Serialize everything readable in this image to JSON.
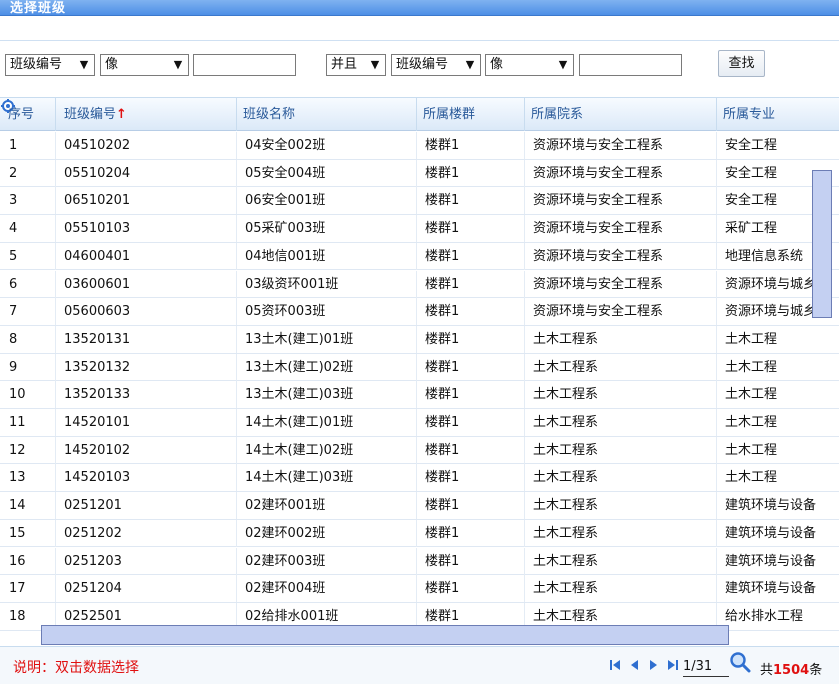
{
  "window": {
    "title": "选择班级"
  },
  "filter": {
    "field1": "班级编号",
    "op1": "像",
    "value1": "",
    "logic": "并且",
    "field2": "班级编号",
    "op2": "像",
    "value2": "",
    "search_label": "查找"
  },
  "table": {
    "columns": [
      "序号",
      "班级编号",
      "班级名称",
      "所属楼群",
      "所属院系",
      "所属专业"
    ],
    "sort_indicator": "↑",
    "rows": [
      [
        "1",
        "04510202",
        "04安全002班",
        "楼群1",
        "资源环境与安全工程系",
        "安全工程"
      ],
      [
        "2",
        "05510204",
        "05安全004班",
        "楼群1",
        "资源环境与安全工程系",
        "安全工程"
      ],
      [
        "3",
        "06510201",
        "06安全001班",
        "楼群1",
        "资源环境与安全工程系",
        "安全工程"
      ],
      [
        "4",
        "05510103",
        "05采矿003班",
        "楼群1",
        "资源环境与安全工程系",
        "采矿工程"
      ],
      [
        "5",
        "04600401",
        "04地信001班",
        "楼群1",
        "资源环境与安全工程系",
        "地理信息系统"
      ],
      [
        "6",
        "03600601",
        "03级资环001班",
        "楼群1",
        "资源环境与安全工程系",
        "资源环境与城乡"
      ],
      [
        "7",
        "05600603",
        "05资环003班",
        "楼群1",
        "资源环境与安全工程系",
        "资源环境与城乡"
      ],
      [
        "8",
        "13520131",
        "13土木(建工)01班",
        "楼群1",
        "土木工程系",
        "土木工程"
      ],
      [
        "9",
        "13520132",
        "13土木(建工)02班",
        "楼群1",
        "土木工程系",
        "土木工程"
      ],
      [
        "10",
        "13520133",
        "13土木(建工)03班",
        "楼群1",
        "土木工程系",
        "土木工程"
      ],
      [
        "11",
        "14520101",
        "14土木(建工)01班",
        "楼群1",
        "土木工程系",
        "土木工程"
      ],
      [
        "12",
        "14520102",
        "14土木(建工)02班",
        "楼群1",
        "土木工程系",
        "土木工程"
      ],
      [
        "13",
        "14520103",
        "14土木(建工)03班",
        "楼群1",
        "土木工程系",
        "土木工程"
      ],
      [
        "14",
        "0251201",
        "02建环001班",
        "楼群1",
        "土木工程系",
        "建筑环境与设备"
      ],
      [
        "15",
        "0251202",
        "02建环002班",
        "楼群1",
        "土木工程系",
        "建筑环境与设备"
      ],
      [
        "16",
        "0251203",
        "02建环003班",
        "楼群1",
        "土木工程系",
        "建筑环境与设备"
      ],
      [
        "17",
        "0251204",
        "02建环004班",
        "楼群1",
        "土木工程系",
        "建筑环境与设备"
      ],
      [
        "18",
        "0252501",
        "02给排水001班",
        "楼群1",
        "土木工程系",
        "给水排水工程"
      ]
    ]
  },
  "footer": {
    "note": "说明：双击数据选择",
    "page": "1/31",
    "total_prefix": "共",
    "total": "1504",
    "total_suffix": "条"
  },
  "icons": {
    "first": "first-page-icon",
    "prev": "prev-page-icon",
    "next": "next-page-icon",
    "last": "last-page-icon",
    "go": "magnifier-icon",
    "settings": "settings-gear-icon"
  },
  "colors": {
    "accent": "#2a5a9a",
    "note": "#e01010",
    "titlebar": "#4d8fe6"
  }
}
